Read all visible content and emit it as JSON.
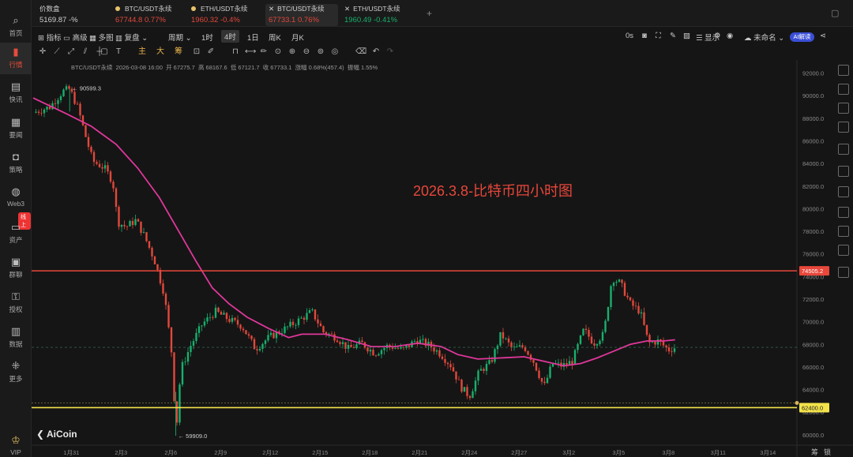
{
  "nav": {
    "items": [
      {
        "label": "首页",
        "icon": "home-icon"
      },
      {
        "label": "行情",
        "icon": "chart-icon"
      },
      {
        "label": "快讯",
        "icon": "news-icon"
      },
      {
        "label": "要闻",
        "icon": "article-icon"
      },
      {
        "label": "策略",
        "icon": "robot-icon"
      },
      {
        "label": "Web3",
        "icon": "globe-icon"
      },
      {
        "label": "资产",
        "icon": "wallet-icon"
      },
      {
        "label": "群聊",
        "icon": "chat-icon"
      },
      {
        "label": "授权",
        "icon": "key-icon"
      },
      {
        "label": "数据",
        "icon": "data-icon"
      },
      {
        "label": "更多",
        "icon": "more-icon"
      },
      {
        "label": "VIP",
        "icon": "vip-icon"
      }
    ],
    "badge": "线上"
  },
  "tabs": [
    {
      "name": "价数盒",
      "price": "5169.87",
      "change": "-%"
    },
    {
      "name": "BTC/USDT永续",
      "price": "67744.8",
      "change": "0.77%"
    },
    {
      "name": "ETH/USDT永续",
      "price": "1960.32",
      "change": "-0.4%"
    },
    {
      "name": "BTC/USDT永续",
      "price": "67733.1",
      "change": "0.76%"
    },
    {
      "name": "ETH/USDT永续",
      "price": "1960.49",
      "change": "-0.41%"
    }
  ],
  "add_tab": "+",
  "toolbar": {
    "indicator": "指标",
    "pro": "高级",
    "multi": "多图",
    "replay": "复盘",
    "period": "周期",
    "t1h": "1时",
    "t4h": "4时",
    "t1d": "1日",
    "t1w": "周K",
    "t1m": "月K",
    "zero_s": "0s",
    "display": "显示",
    "unnamed": "未命名",
    "ai": "AI解读"
  },
  "drawbar": {
    "zhu": "主",
    "da": "大",
    "chou": "筹"
  },
  "ohlc": {
    "symbol": "BTC/USDT永续",
    "time": "2026-03-08 16:00",
    "open": "开 67275.7",
    "high": "高 68167.6",
    "low": "低 67121.7",
    "close": "收 67733.1",
    "change": "涨幅 0.68%(457.4)",
    "amplitude": "振幅 1.55%"
  },
  "annotation": "2026.3.8-比特币四小时图",
  "logo": "AiCoin",
  "bottom": {
    "chips": "筹",
    "lock": "锁"
  },
  "colors": {
    "up": "#18b06c",
    "down": "#e2483c",
    "ma": "#e0379a",
    "res_line": "#e8473b",
    "sup_line": "#f3e34a"
  },
  "chart_data": {
    "type": "candlestick",
    "title": "",
    "ylim": [
      59500,
      92600
    ],
    "y_ticks": [
      60000,
      62000,
      64000,
      66000,
      68000,
      70000,
      72000,
      74000,
      76000,
      78000,
      80000,
      82000,
      84000,
      86000,
      88000,
      90000,
      92000
    ],
    "x_ticks": [
      {
        "label": "1月31",
        "t": 2.3
      },
      {
        "label": "2月3",
        "t": 5.3
      },
      {
        "label": "2月6",
        "t": 8.3
      },
      {
        "label": "2月9",
        "t": 11.3
      },
      {
        "label": "2月12",
        "t": 14.3
      },
      {
        "label": "2月15",
        "t": 17.3
      },
      {
        "label": "2月18",
        "t": 20.3
      },
      {
        "label": "2月21",
        "t": 23.3
      },
      {
        "label": "2月24",
        "t": 26.3
      },
      {
        "label": "2月27",
        "t": 29.3
      },
      {
        "label": "3月2",
        "t": 32.3
      },
      {
        "label": "3月5",
        "t": 35.3
      },
      {
        "label": "3月8",
        "t": 38.3
      },
      {
        "label": "3月11",
        "t": 41.3
      },
      {
        "label": "3月14",
        "t": 44.3
      }
    ],
    "t_range": [
      0,
      46
    ],
    "price_path": [
      [
        0,
        88500
      ],
      [
        1.0,
        89000
      ],
      [
        1.8,
        90400
      ],
      [
        2.2,
        90599
      ],
      [
        2.7,
        88900
      ],
      [
        3.2,
        86200
      ],
      [
        3.6,
        84200
      ],
      [
        4.3,
        83600
      ],
      [
        4.8,
        82400
      ],
      [
        5.1,
        78800
      ],
      [
        5.6,
        78400
      ],
      [
        6.2,
        79000
      ],
      [
        6.7,
        77600
      ],
      [
        7.3,
        75500
      ],
      [
        7.9,
        72500
      ],
      [
        8.4,
        66600
      ],
      [
        8.6,
        59909
      ],
      [
        8.9,
        65800
      ],
      [
        9.5,
        67900
      ],
      [
        10.2,
        69800
      ],
      [
        11.0,
        70900
      ],
      [
        11.8,
        70200
      ],
      [
        12.6,
        69600
      ],
      [
        13.4,
        67600
      ],
      [
        14.2,
        68600
      ],
      [
        15.2,
        69400
      ],
      [
        16.2,
        70300
      ],
      [
        16.8,
        70900
      ],
      [
        17.5,
        69100
      ],
      [
        18.3,
        68600
      ],
      [
        19.0,
        67600
      ],
      [
        19.8,
        68100
      ],
      [
        20.6,
        67200
      ],
      [
        21.4,
        67900
      ],
      [
        22.3,
        67500
      ],
      [
        23.1,
        68400
      ],
      [
        23.9,
        67900
      ],
      [
        24.6,
        67100
      ],
      [
        25.2,
        66100
      ],
      [
        25.8,
        64200
      ],
      [
        26.3,
        63400
      ],
      [
        26.9,
        65600
      ],
      [
        27.6,
        66400
      ],
      [
        28.2,
        68900
      ],
      [
        28.9,
        67600
      ],
      [
        29.6,
        67800
      ],
      [
        30.2,
        66400
      ],
      [
        30.8,
        64200
      ],
      [
        31.3,
        66300
      ],
      [
        31.9,
        66100
      ],
      [
        32.5,
        66500
      ],
      [
        33.2,
        69300
      ],
      [
        33.8,
        68100
      ],
      [
        34.4,
        68900
      ],
      [
        34.9,
        73900
      ],
      [
        35.4,
        73400
      ],
      [
        36.0,
        71600
      ],
      [
        36.6,
        70900
      ],
      [
        37.1,
        68100
      ],
      [
        37.7,
        68300
      ],
      [
        38.3,
        67500
      ],
      [
        38.7,
        67733
      ]
    ],
    "series": [
      {
        "name": "",
        "kind": "ma",
        "points": [
          [
            0,
            89800
          ],
          [
            2.0,
            88400
          ],
          [
            3.5,
            87300
          ],
          [
            5.0,
            85700
          ],
          [
            6.3,
            83600
          ],
          [
            7.6,
            81000
          ],
          [
            8.7,
            78200
          ],
          [
            9.8,
            75400
          ],
          [
            10.8,
            73000
          ],
          [
            11.8,
            71600
          ],
          [
            12.9,
            70400
          ],
          [
            14.2,
            69400
          ],
          [
            15.4,
            68600
          ],
          [
            16.2,
            68900
          ],
          [
            17.6,
            68900
          ],
          [
            19.0,
            68400
          ],
          [
            20.4,
            67800
          ],
          [
            21.8,
            67800
          ],
          [
            23.2,
            68100
          ],
          [
            24.6,
            67800
          ],
          [
            25.6,
            67100
          ],
          [
            26.8,
            66700
          ],
          [
            28.2,
            66800
          ],
          [
            29.6,
            66900
          ],
          [
            30.8,
            66500
          ],
          [
            32.0,
            66100
          ],
          [
            33.0,
            66300
          ],
          [
            34.0,
            66800
          ],
          [
            35.0,
            67400
          ],
          [
            36.0,
            68000
          ],
          [
            37.0,
            68300
          ],
          [
            38.0,
            68300
          ],
          [
            38.7,
            68400
          ]
        ]
      }
    ],
    "last_price": 67733.1,
    "annotations": {
      "high_label": "90599.3",
      "low_label": "59909.0",
      "resistance": 74505.2,
      "resistance_label": "74505.2",
      "support": 62400.0,
      "support_label": "62400.0"
    }
  }
}
